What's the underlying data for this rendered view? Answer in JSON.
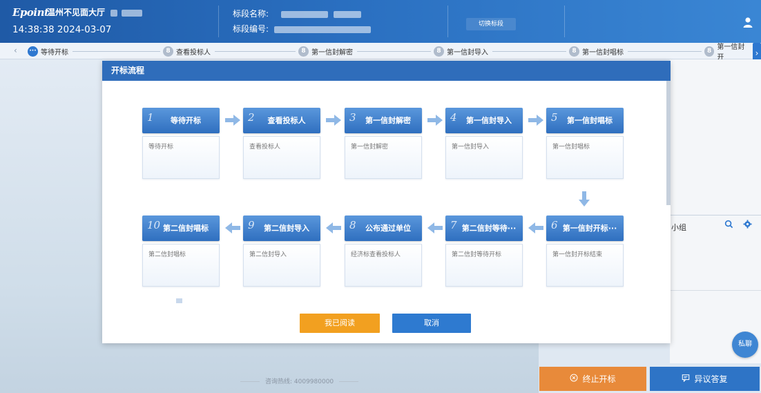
{
  "header": {
    "logo": "Epoint",
    "hall_name": "温州不见面大厅",
    "clock": "14:38:38 2024-03-07",
    "section_name_label": "标段名称:",
    "section_code_label": "标段编号:",
    "switch_section": "切换标段"
  },
  "stepbar": {
    "steps": [
      {
        "label": "等待开标",
        "dot": "···"
      },
      {
        "label": "查看投标人",
        "dot": "8"
      },
      {
        "label": "第一信封解密",
        "dot": "8"
      },
      {
        "label": "第一信封导入",
        "dot": "8"
      },
      {
        "label": "第一信封唱标",
        "dot": "8"
      },
      {
        "label": "第一信封开",
        "dot": "8"
      }
    ]
  },
  "modal": {
    "title": "开标流程",
    "steps": [
      {
        "num": "1",
        "title": "等待开标",
        "desc": "等待开标"
      },
      {
        "num": "2",
        "title": "查看投标人",
        "desc": "查看投标人"
      },
      {
        "num": "3",
        "title": "第一信封解密",
        "desc": "第一信封解密"
      },
      {
        "num": "4",
        "title": "第一信封导入",
        "desc": "第一信封导入"
      },
      {
        "num": "5",
        "title": "第一信封唱标",
        "desc": "第一信封唱标"
      },
      {
        "num": "6",
        "title": "第一信封开标···",
        "desc": "第一信封开标结束"
      },
      {
        "num": "7",
        "title": "第二信封等待···",
        "desc": "第二信封等待开标"
      },
      {
        "num": "8",
        "title": "公布通过单位",
        "desc": "经济标查看投标人"
      },
      {
        "num": "9",
        "title": "第二信封导入",
        "desc": "第二信封导入"
      },
      {
        "num": "10",
        "title": "第二信封唱标",
        "desc": "第二信封唱标"
      }
    ],
    "confirm": "我已阅读",
    "cancel": "取消"
  },
  "right_panel": {
    "group_label": "小组",
    "chat": "私聊"
  },
  "footer": {
    "hotline": "咨询热线: 4009980000",
    "stop_bid": "终止开标",
    "objection_reply": "异议答复"
  },
  "colors": {
    "header_blue": "#2a6fc0",
    "step_blue": "#2f6fbf",
    "confirm_orange": "#f2a020",
    "stop_orange": "#e88a3a"
  }
}
